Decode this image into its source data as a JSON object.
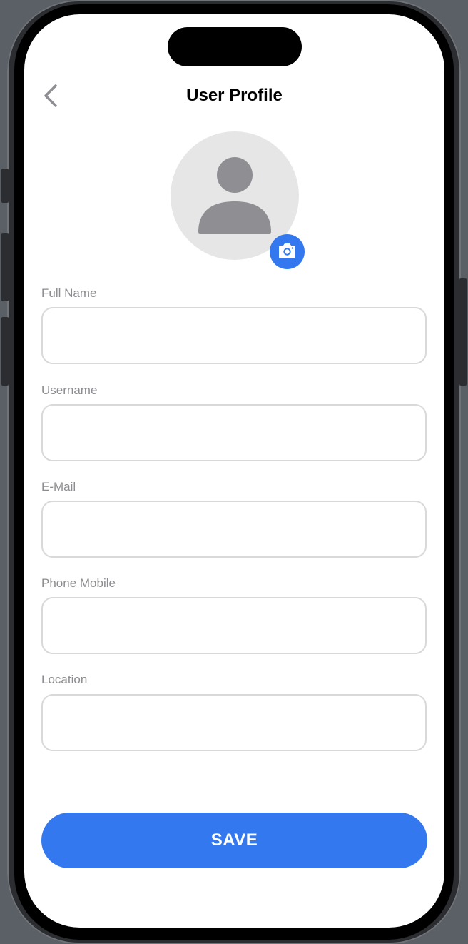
{
  "header": {
    "title": "User Profile",
    "back_icon": "chevron-left-icon"
  },
  "avatar": {
    "placeholder_icon": "person-icon",
    "edit_icon": "camera-icon",
    "edit_color": "#3478f0"
  },
  "form": {
    "fields": [
      {
        "label": "Full Name",
        "value": "",
        "placeholder": ""
      },
      {
        "label": "Username",
        "value": "",
        "placeholder": ""
      },
      {
        "label": "E-Mail",
        "value": "",
        "placeholder": ""
      },
      {
        "label": "Phone Mobile",
        "value": "",
        "placeholder": ""
      },
      {
        "label": "Location",
        "value": "",
        "placeholder": ""
      }
    ]
  },
  "actions": {
    "save_label": "SAVE",
    "accent_color": "#3478f0"
  }
}
